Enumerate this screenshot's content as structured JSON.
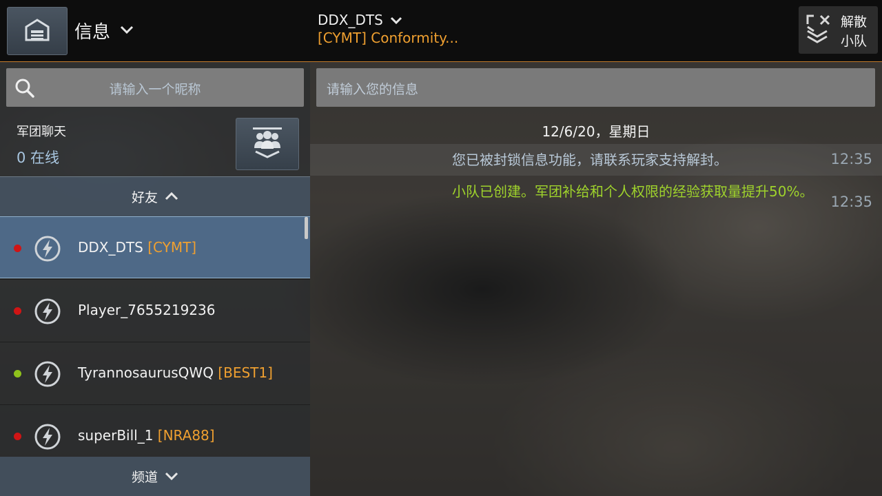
{
  "header": {
    "menu_title": "信息",
    "chat_target": "DDX_DTS",
    "chat_subtitle": "[CYMT] Conformity...",
    "disband_line1": "解散",
    "disband_line2": "小队"
  },
  "sidebar": {
    "search_placeholder": "请输入一个昵称",
    "legion_chat_label": "军团聊天",
    "legion_online": "0 在线",
    "friends_header": "好友",
    "channels_header": "频道",
    "friends": [
      {
        "name": "DDX_DTS",
        "tag": "[CYMT]",
        "status_color": "#d01515",
        "selected": true
      },
      {
        "name": "Player_7655219236",
        "tag": "",
        "status_color": "#d01515",
        "selected": false
      },
      {
        "name": "TyrannosaurusQWQ",
        "tag": "[BEST1]",
        "status_color": "#8fc21c",
        "selected": false
      },
      {
        "name": "superBill_1",
        "tag": "[NRA88]",
        "status_color": "#d01515",
        "selected": false
      }
    ]
  },
  "chat": {
    "input_placeholder": "请输入您的信息",
    "date": "12/6/20，星期日",
    "messages": [
      {
        "text": "您已被封锁信息功能，请联系玩家支持解封。",
        "time": "12:35",
        "color": "#b9c9d8"
      },
      {
        "text": "小队已创建。军团补给和个人权限的经验获取量提升50%。",
        "time": "12:35",
        "color": "#9fd32c"
      }
    ]
  },
  "colors": {
    "accent_orange": "#f0a030",
    "selected_row": "#547396",
    "system_green": "#9fd32c"
  },
  "icons": {
    "home": "hangar-home-icon",
    "dropdown": "chevron-down-icon",
    "disband": "disband-squad-icon",
    "search": "search-icon",
    "legion": "legion-group-icon",
    "friend": "lightning-badge-icon"
  }
}
